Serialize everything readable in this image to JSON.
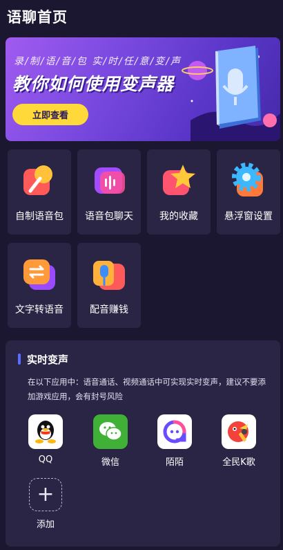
{
  "page": {
    "title": "语聊首页"
  },
  "banner": {
    "tagline": "录/制/语/音/包    实/时/任/意/变/声",
    "headline": "教你如何使用变声器",
    "cta": "立即查看"
  },
  "grid": [
    {
      "label": "自制语音包",
      "icon": "microphone-icon"
    },
    {
      "label": "语音包聊天",
      "icon": "voice-wave-icon"
    },
    {
      "label": "我的收藏",
      "icon": "star-icon"
    },
    {
      "label": "悬浮窗设置",
      "icon": "gear-icon"
    },
    {
      "label": "文字转语音",
      "icon": "convert-icon"
    },
    {
      "label": "配音赚钱",
      "icon": "dubbing-icon"
    }
  ],
  "realtime": {
    "title": "实时变声",
    "description": "在以下应用中：语音通话、视频通话中可实现实时变声，建议不要添加游戏应用，会有封号风险",
    "apps": [
      {
        "name": "QQ",
        "icon": "qq-icon"
      },
      {
        "name": "微信",
        "icon": "wechat-icon"
      },
      {
        "name": "陌陌",
        "icon": "momo-icon"
      },
      {
        "name": "全民K歌",
        "icon": "kge-icon"
      }
    ],
    "add_label": "添加"
  },
  "colors": {
    "background": "#1b1730",
    "card": "#2b2545",
    "accent": "#5b6cff",
    "cta": "#ffd83a"
  }
}
